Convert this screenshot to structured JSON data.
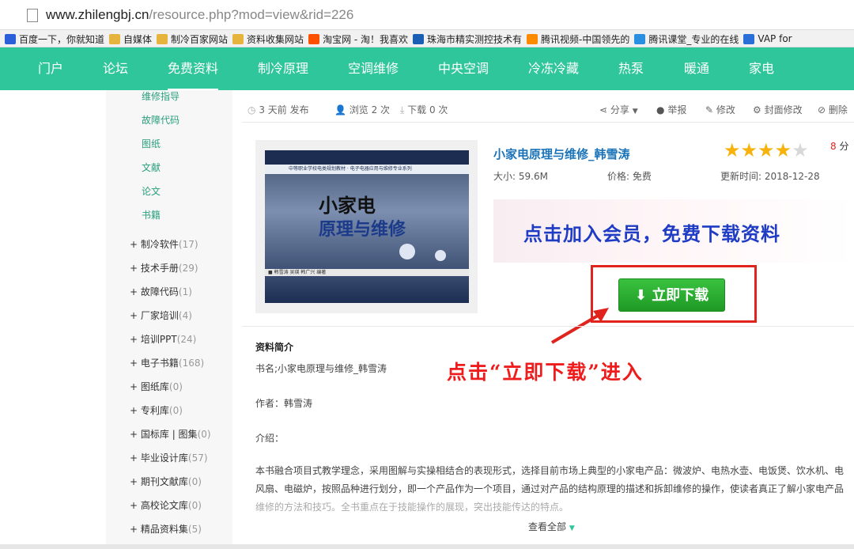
{
  "browser": {
    "url_host": "www.zhilengbj.cn",
    "url_path": "/resource.php?mod=view&rid=226"
  },
  "bookmarks": [
    {
      "label": "百度一下，你就知道",
      "icon": "paw-icon",
      "color": "#2b5fd9"
    },
    {
      "label": "自媒体",
      "icon": "folder-icon",
      "color": "#e6b43c"
    },
    {
      "label": "制冷百家网站",
      "icon": "folder-icon",
      "color": "#e6b43c"
    },
    {
      "label": "资料收集网站",
      "icon": "folder-icon",
      "color": "#e6b43c"
    },
    {
      "label": "淘宝网 - 淘！我喜欢",
      "icon": "taobao-icon",
      "color": "#ff5000"
    },
    {
      "label": "珠海市精实测控技术有",
      "icon": "logo-icon",
      "color": "#1a5fb4"
    },
    {
      "label": "腾讯视频-中国领先的",
      "icon": "play-icon",
      "color": "#ff8a00"
    },
    {
      "label": "腾讯课堂_专业的在线",
      "icon": "diamond-icon",
      "color": "#2a8fe0"
    },
    {
      "label": "VAP for",
      "icon": "snowflake-icon",
      "color": "#2a6fd8"
    }
  ],
  "nav": {
    "items": [
      "门户",
      "论坛",
      "免费资料",
      "制冷原理",
      "空调维修",
      "中央空调",
      "冷冻冷藏",
      "热泵",
      "暖通",
      "家电"
    ],
    "active": "免费资料",
    "bg_color": "#2fc69b"
  },
  "sidebar": {
    "sub_items": [
      "维修指导",
      "故障代码",
      "图纸",
      "文献",
      "论文",
      "书籍"
    ],
    "categories": [
      {
        "label": "制冷软件",
        "count": "(17)"
      },
      {
        "label": "技术手册",
        "count": "(29)"
      },
      {
        "label": "故障代码",
        "count": "(1)"
      },
      {
        "label": "厂家培训",
        "count": "(4)"
      },
      {
        "label": "培训PPT",
        "count": "(24)"
      },
      {
        "label": "电子书籍",
        "count": "(168)"
      },
      {
        "label": "图纸库",
        "count": "(0)"
      },
      {
        "label": "专利库",
        "count": "(0)"
      },
      {
        "label": "国标库 | 图集",
        "count": "(0)"
      },
      {
        "label": "毕业设计库",
        "count": "(57)"
      },
      {
        "label": "期刊文献库",
        "count": "(0)"
      },
      {
        "label": "高校论文库",
        "count": "(0)"
      },
      {
        "label": "精品资料集",
        "count": "(5)"
      }
    ]
  },
  "meta": {
    "published": "3 天前 发布",
    "views": "浏览 2 次",
    "downloads": "下载 0 次",
    "share": "分享",
    "report": "举报",
    "edit": "修改",
    "cover_edit": "封面修改",
    "delete": "删除"
  },
  "book_cover": {
    "series": "中等职业学校电类规划教材 · 电子电器应用与维修专业系列",
    "title_line1": "小家电",
    "title_line2": "原理与维修",
    "author_line": "■ 韩雪涛 吴瑛 韩广兴 编著"
  },
  "resource": {
    "title": "小家电原理与维修_韩雪涛",
    "rating": 4,
    "score_value": "8",
    "score_unit": "分",
    "size": "大小: 59.6M",
    "price": "价格: 免费",
    "updated": "更新时间: 2018-12-28",
    "banner_text": "点击加入会员，免费下载资料",
    "download_label": "立即下载",
    "annotation": "点击“立即下载”进入"
  },
  "description": {
    "heading": "资料简介",
    "book_name": "书名;小家电原理与维修_韩雪涛",
    "author": "作者：韩雪涛",
    "intro_label": "介绍：",
    "para_line1": "本书融合项目式教学理念，采用图解与实操相结合的表现形式，选择目前市场上典型的小家电产品：微波炉、电热水壶、电饭煲、饮水机、电",
    "para_line2": "风扇、电磁炉，按照品种进行划分，即一个产品作为一个项目，通过对产品的结构原理的描述和拆卸维修的操作，使读者真正了解小家电产品",
    "para_line3": "维修的方法和技巧。全书重点在于技能操作的展现，突出技能传达的特点。",
    "show_all": "查看全部"
  }
}
